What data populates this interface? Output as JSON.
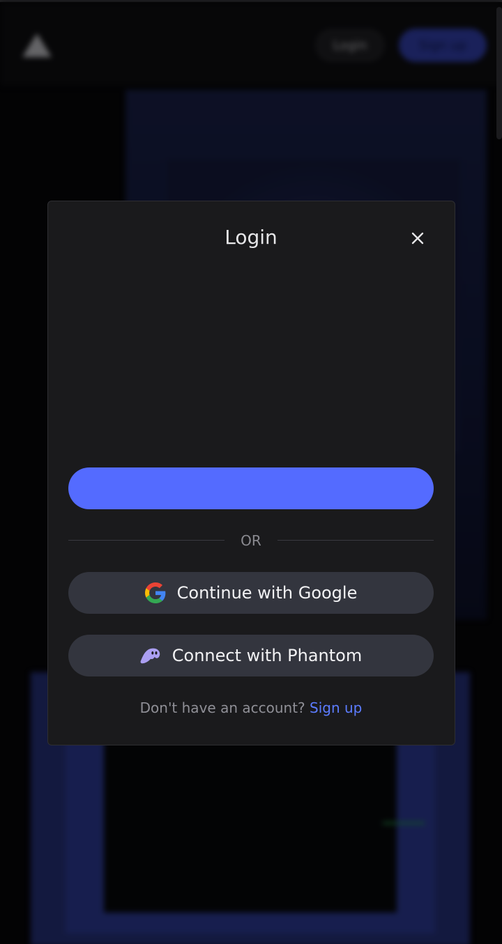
{
  "background": {
    "header": {
      "login_label": "Login",
      "signup_label": "Sign up"
    }
  },
  "modal": {
    "title": "Login",
    "close_icon": "close-icon",
    "primary_button_label": "",
    "divider_text": "OR",
    "google_button": {
      "label": "Continue with Google",
      "icon": "google-icon"
    },
    "phantom_button": {
      "label": "Connect with Phantom",
      "icon": "phantom-icon"
    },
    "footer": {
      "prompt": "Don't have an account?",
      "link": "Sign up"
    }
  },
  "colors": {
    "primary": "#546bff",
    "modal_bg": "#1a1a1c",
    "social_bg": "#33353e",
    "link": "#5c7cff",
    "phantom": "#ab9ff2"
  }
}
